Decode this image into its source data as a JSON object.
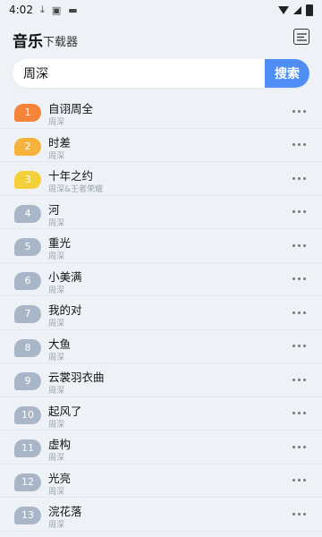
{
  "status_bar": {
    "time": "4:02",
    "icons": [
      "download-icon",
      "a-badge-icon",
      "keyboard-icon",
      "wifi-icon",
      "signal-icon",
      "battery-icon"
    ]
  },
  "header": {
    "title": "音乐",
    "subtitle": "下载器",
    "menu_icon": "list-menu-icon"
  },
  "search": {
    "value": "周深",
    "placeholder": "",
    "button_label": "搜索",
    "button_color": "#4f8ef7"
  },
  "rank_colors": {
    "top1": "#f5843a",
    "top2": "#f7b23e",
    "top3": "#f5cf3a",
    "default": "#a9b6c8"
  },
  "songs": [
    {
      "rank": "1",
      "title": "自诩周全",
      "artist": "周深"
    },
    {
      "rank": "2",
      "title": "时差",
      "artist": "周深"
    },
    {
      "rank": "3",
      "title": "十年之约",
      "artist": "周深&王者荣耀"
    },
    {
      "rank": "4",
      "title": "河",
      "artist": "周深"
    },
    {
      "rank": "5",
      "title": "重光",
      "artist": "周深"
    },
    {
      "rank": "6",
      "title": "小美满",
      "artist": "周深"
    },
    {
      "rank": "7",
      "title": "我的对",
      "artist": "周深"
    },
    {
      "rank": "8",
      "title": "大鱼",
      "artist": "周深"
    },
    {
      "rank": "9",
      "title": "云裳羽衣曲",
      "artist": "周深"
    },
    {
      "rank": "10",
      "title": "起风了",
      "artist": "周深"
    },
    {
      "rank": "11",
      "title": "虚构",
      "artist": "周深"
    },
    {
      "rank": "12",
      "title": "光亮",
      "artist": "周深"
    },
    {
      "rank": "13",
      "title": "浣花落",
      "artist": "周深"
    }
  ]
}
